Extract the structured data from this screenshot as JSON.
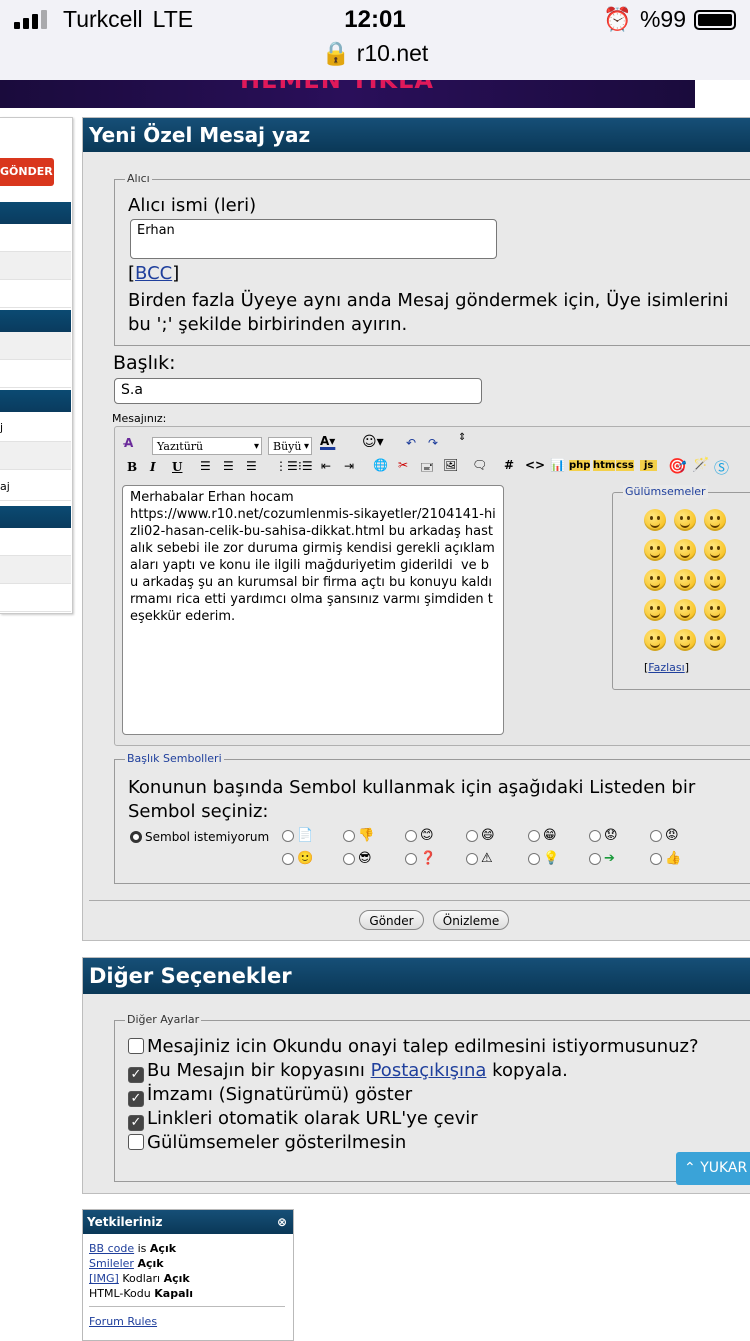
{
  "status": {
    "carrier": "Turkcell",
    "network": "LTE",
    "time": "12:01",
    "url": "r10.net",
    "battery": "%99"
  },
  "banner": {
    "text": "HEMEN TIKLA"
  },
  "sidebar": {
    "send_button": "GÖNDER",
    "items": [
      "j",
      "aj"
    ]
  },
  "compose": {
    "title": "Yeni Özel Mesaj yaz",
    "recipient_legend": "Alıcı",
    "recipient_label": "Alıcı ismi (leri)",
    "recipient_value": "Erhan",
    "bcc_link": "BCC",
    "bcc_open": "[",
    "bcc_close": "]",
    "recipient_hint": "Birden fazla Üyeye aynı anda Mesaj göndermek için, Üye isimlerini bu ';' şekilde birbirinden ayırın.",
    "subject_label": "Başlık:",
    "subject_value": "S.a",
    "message_label": "Mesajınız:",
    "font_select": "Yazıtürü",
    "size_select": "Büyü",
    "message_text": "Merhabalar Erhan hocam\nhttps://www.r10.net/cozumlenmis-sikayetler/2104141-hizli02-hasan-celik-bu-sahisa-dikkat.html bu arkadaş hastalık sebebi ile zor duruma girmiş kendisi gerekli açıklamaları yaptı ve konu ile ilgili mağduriyetim giderildi  ve bu arkadaş şu an kurumsal bir firma açtı bu konuyu kaldırmamı rica etti yardımcı olma şansınız varmı şimdiden teşekkür ederim.",
    "smilies_legend": "Gülümsemeler",
    "more_link": "Fazlası",
    "icons_legend": "Başlık Sembolleri",
    "icons_hint": "Konunun başında Sembol kullanmak için aşağıdaki Listeden bir Sembol seçiniz:",
    "no_icon": "Sembol istemiyorum",
    "send": "Gönder",
    "preview": "Önizleme"
  },
  "toolbar_tags": {
    "php": "php",
    "htm": "htm",
    "css": "css",
    "js": "js"
  },
  "other": {
    "title": "Diğer Seçenekler",
    "legend": "Diğer Ayarlar",
    "options": [
      {
        "label": "Mesajiniz icin Okundu onayi talep edilmesini istiyormusunuz?",
        "checked": false
      },
      {
        "label_a": "Bu Mesajın bir kopyasını ",
        "link": "Postaçıkışına",
        "label_b": " kopyala.",
        "checked": true
      },
      {
        "label": "İmzamı (Signatürümü) göster",
        "checked": true
      },
      {
        "label": "Linkleri otomatik olarak URL'ye çevir",
        "checked": true
      },
      {
        "label": "Gülümsemeler gösterilmesin",
        "checked": false
      }
    ],
    "scroll_top": "YUKAR"
  },
  "permissions": {
    "title": "Yetkileriniz",
    "rows": [
      {
        "k": "BB code",
        "mid": " is ",
        "v": "Açık"
      },
      {
        "k": "Smileler",
        "mid": " ",
        "v": "Açık"
      },
      {
        "k": "[IMG]",
        "mid": " Kodları ",
        "v": "Açık"
      },
      {
        "k": "HTML-Kodu",
        "mid": " ",
        "v": "Kapalı"
      }
    ],
    "rules": "Forum Rules"
  },
  "colors": {
    "header": "#0a3857",
    "accent": "#d9361d",
    "link": "#1f3f9c",
    "scroll": "#3aa3d8"
  }
}
